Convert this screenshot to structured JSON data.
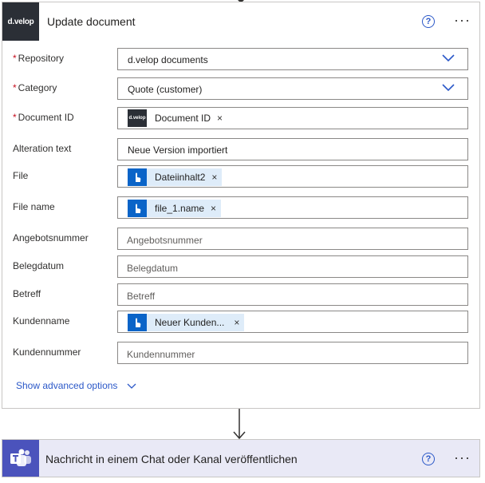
{
  "header": {
    "logo_text": "d.velop",
    "title": "Update document",
    "help_label": "?",
    "more_label": "···"
  },
  "fields": {
    "repository": {
      "label": "Repository",
      "required": "*",
      "value": "d.velop documents"
    },
    "category": {
      "label": "Category",
      "required": "*",
      "value": "Quote (customer)"
    },
    "document_id": {
      "label": "Document ID",
      "required": "*",
      "token": "Document ID",
      "token_icon_text": "d.velop"
    },
    "alteration_text": {
      "label": "Alteration text",
      "value": "Neue Version importiert"
    },
    "file": {
      "label": "File",
      "token": "Dateiinhalt2"
    },
    "file_name": {
      "label": "File name",
      "token": "file_1.name"
    },
    "angebotsnummer": {
      "label": "Angebotsnummer",
      "placeholder": "Angebotsnummer"
    },
    "belegdatum": {
      "label": "Belegdatum",
      "placeholder": "Belegdatum"
    },
    "betreff": {
      "label": "Betreff",
      "placeholder": "Betreff"
    },
    "kundenname": {
      "label": "Kundenname",
      "token": "Neuer Kunden..."
    },
    "kundennummer": {
      "label": "Kundennummer",
      "placeholder": "Kundennummer"
    }
  },
  "token_remove": "×",
  "advanced": {
    "label": "Show advanced options"
  },
  "next_action": {
    "title": "Nachricht in einem Chat oder Kanal veröffentlichen",
    "help_label": "?",
    "more_label": "···"
  },
  "colors": {
    "accent": "#2b58c8",
    "token_bg": "#deecf9",
    "required": "#c50f1f",
    "teams": "#4b53bc"
  },
  "icons": {
    "dropdown": "chevron-down-icon",
    "token": "touch-hand-icon",
    "teams": "teams-icon"
  }
}
